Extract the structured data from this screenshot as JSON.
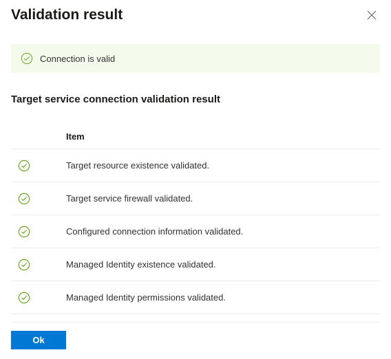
{
  "header": {
    "title": "Validation result"
  },
  "status": {
    "message": "Connection is valid"
  },
  "section": {
    "title": "Target service connection validation result"
  },
  "table": {
    "header": {
      "item": "Item"
    },
    "rows": [
      {
        "item": "Target resource existence validated."
      },
      {
        "item": "Target service firewall validated."
      },
      {
        "item": "Configured connection information validated."
      },
      {
        "item": "Managed Identity existence validated."
      },
      {
        "item": "Managed Identity permissions validated."
      }
    ]
  },
  "footer": {
    "ok_label": "Ok"
  }
}
